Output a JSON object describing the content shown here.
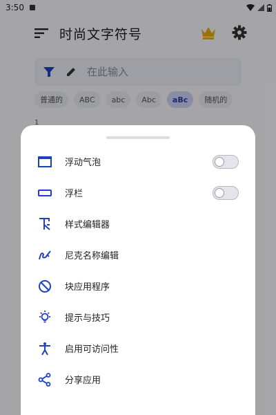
{
  "status_bar": {
    "time": "3:50"
  },
  "app_bar": {
    "title": "时尚文字符号"
  },
  "input": {
    "placeholder": "在此输入"
  },
  "style_chips": [
    {
      "label": "普通的"
    },
    {
      "label": "ABC"
    },
    {
      "label": "abc"
    },
    {
      "label": "Abc"
    },
    {
      "label": "aBc",
      "selected": true
    },
    {
      "label": "随机的"
    }
  ],
  "line_number": "1",
  "colors": {
    "accent": "#1e3fc4",
    "crown": "#e3a51a"
  },
  "sheet": {
    "items": [
      {
        "label": "浮动气泡",
        "icon": "window-icon",
        "toggle": false
      },
      {
        "label": "浮栏",
        "icon": "bar-icon",
        "toggle": false
      },
      {
        "label": "样式编辑器",
        "icon": "text-style-icon"
      },
      {
        "label": "尼克名称编辑",
        "icon": "signature-icon"
      },
      {
        "label": "块应用程序",
        "icon": "block-icon"
      },
      {
        "label": "提示与技巧",
        "icon": "lightbulb-icon"
      },
      {
        "label": "启用可访问性",
        "icon": "accessibility-icon"
      },
      {
        "label": "分享应用",
        "icon": "share-icon"
      }
    ]
  }
}
